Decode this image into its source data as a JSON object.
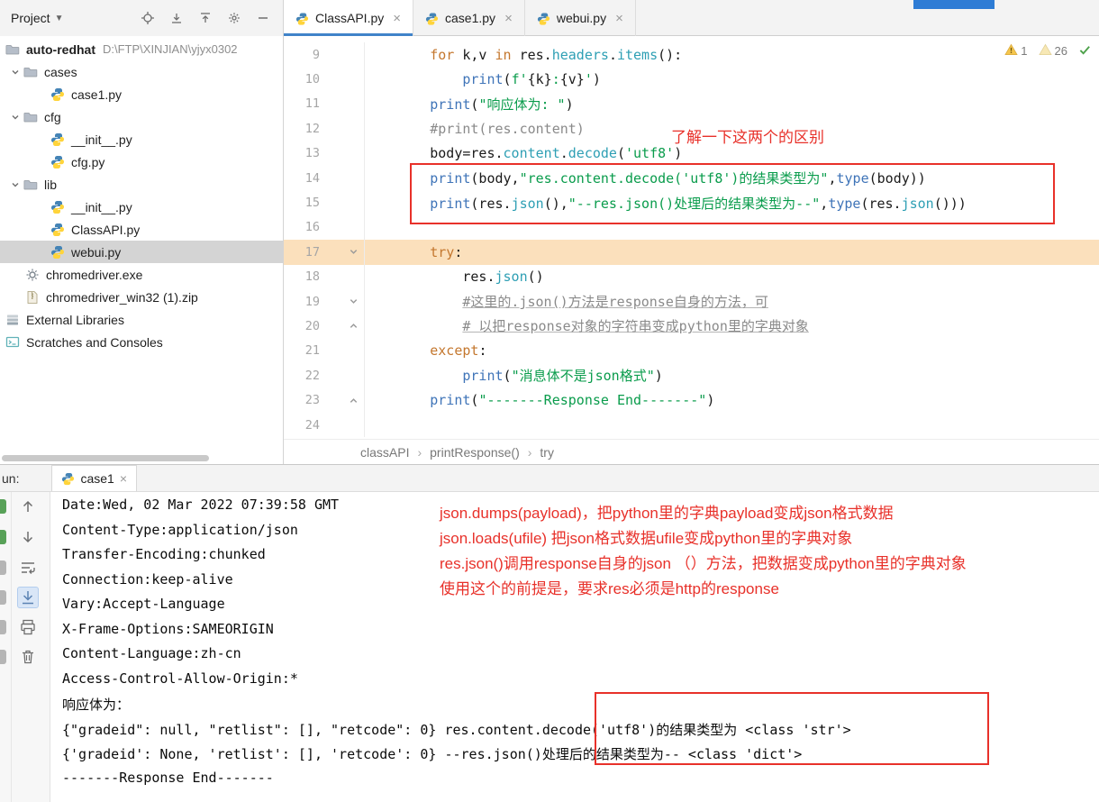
{
  "project_panel": {
    "header": {
      "title": "Project"
    },
    "tree": [
      {
        "label": "auto-redhat",
        "suffix": "D:\\FTP\\XINJIAN\\yjyx0302",
        "icon": "folder",
        "flush": true,
        "bold": true
      },
      {
        "label": "cases",
        "icon": "folder",
        "arrow": true
      },
      {
        "label": "case1.py",
        "icon": "python",
        "level": 1
      },
      {
        "label": "cfg",
        "icon": "folder",
        "arrow": true
      },
      {
        "label": "__init__.py",
        "icon": "python",
        "level": 1
      },
      {
        "label": "cfg.py",
        "icon": "python",
        "level": 1
      },
      {
        "label": "lib",
        "icon": "folder",
        "arrow": true
      },
      {
        "label": "__init__.py",
        "icon": "python",
        "level": 1
      },
      {
        "label": "ClassAPI.py",
        "icon": "python",
        "level": 1
      },
      {
        "label": "webui.py",
        "icon": "python",
        "level": 1,
        "selected": true
      },
      {
        "label": "chromedriver.exe",
        "icon": "exe",
        "level": 0
      },
      {
        "label": "chromedriver_win32 (1).zip",
        "icon": "zip",
        "level": 0
      },
      {
        "label": "External Libraries",
        "icon": "lib",
        "flush": true
      },
      {
        "label": "Scratches and Consoles",
        "icon": "scratch",
        "flush": true
      }
    ]
  },
  "editor_tabs": [
    {
      "label": "ClassAPI.py",
      "active": true
    },
    {
      "label": "case1.py",
      "active": false
    },
    {
      "label": "webui.py",
      "active": false
    }
  ],
  "inspections": {
    "warning_count": "1",
    "weak_count": "26"
  },
  "editor": {
    "highlight_line": 17,
    "gutter_icons": {
      "17": "fold",
      "19": "fold",
      "20": "foldend",
      "23": "foldend"
    },
    "lines": [
      {
        "num": 9,
        "tokens": [
          [
            "pl",
            "        "
          ],
          [
            "kw",
            "for"
          ],
          [
            "pl",
            " k,v "
          ],
          [
            "kw",
            "in"
          ],
          [
            "pl",
            " res."
          ],
          [
            "mt",
            "headers"
          ],
          [
            "pl",
            "."
          ],
          [
            "mt",
            "items"
          ],
          [
            "pl",
            "():"
          ]
        ]
      },
      {
        "num": 10,
        "tokens": [
          [
            "pl",
            "            "
          ],
          [
            "fn",
            "print"
          ],
          [
            "pl",
            "("
          ],
          [
            "st",
            "f'"
          ],
          [
            "pl",
            "{k}"
          ],
          [
            "st",
            ":"
          ],
          [
            "pl",
            "{v}"
          ],
          [
            "st",
            "'"
          ],
          [
            "pl",
            ")"
          ]
        ]
      },
      {
        "num": 11,
        "tokens": [
          [
            "pl",
            "        "
          ],
          [
            "fn",
            "print"
          ],
          [
            "pl",
            "("
          ],
          [
            "st",
            "\"响应体为: \""
          ],
          [
            "pl",
            ")"
          ]
        ]
      },
      {
        "num": 12,
        "tokens": [
          [
            "pl",
            "        "
          ],
          [
            "cm",
            "#print(res.content)"
          ]
        ]
      },
      {
        "num": 13,
        "tokens": [
          [
            "pl",
            "        "
          ],
          [
            "pl",
            "body="
          ],
          [
            "pl",
            "res."
          ],
          [
            "mt",
            "content"
          ],
          [
            "pl",
            "."
          ],
          [
            "mt",
            "decode"
          ],
          [
            "pl",
            "("
          ],
          [
            "st",
            "'utf8'"
          ],
          [
            "pl",
            ")"
          ]
        ]
      },
      {
        "num": 14,
        "tokens": [
          [
            "pl",
            "        "
          ],
          [
            "fn",
            "print"
          ],
          [
            "pl",
            "(body,"
          ],
          [
            "st",
            "\"res.content.decode('utf8')的结果类型为\""
          ],
          [
            "pl",
            ","
          ],
          [
            "fn",
            "type"
          ],
          [
            "pl",
            "(body))"
          ]
        ]
      },
      {
        "num": 15,
        "tokens": [
          [
            "pl",
            "        "
          ],
          [
            "fn",
            "print"
          ],
          [
            "pl",
            "(res."
          ],
          [
            "mt",
            "json"
          ],
          [
            "pl",
            "(),"
          ],
          [
            "st",
            "\"--res.json()处理后的结果类型为--\""
          ],
          [
            "pl",
            ","
          ],
          [
            "fn",
            "type"
          ],
          [
            "pl",
            "(res."
          ],
          [
            "mt",
            "json"
          ],
          [
            "pl",
            "()))"
          ]
        ]
      },
      {
        "num": 16,
        "tokens": []
      },
      {
        "num": 17,
        "tokens": [
          [
            "pl",
            "        "
          ],
          [
            "kw",
            "try"
          ],
          [
            "pl",
            ":"
          ]
        ]
      },
      {
        "num": 18,
        "tokens": [
          [
            "pl",
            "            "
          ],
          [
            "pl",
            "res."
          ],
          [
            "mt",
            "json"
          ],
          [
            "pl",
            "()"
          ]
        ]
      },
      {
        "num": 19,
        "tokens": [
          [
            "pl",
            "            "
          ],
          [
            "cu",
            "#这里的.json()方法是response自身的方法，可"
          ]
        ]
      },
      {
        "num": 20,
        "tokens": [
          [
            "pl",
            "            "
          ],
          [
            "cu",
            "# 以把response对象的字符串变成python里的字典对象"
          ]
        ]
      },
      {
        "num": 21,
        "tokens": [
          [
            "pl",
            "        "
          ],
          [
            "kw",
            "except"
          ],
          [
            "pl",
            ":"
          ]
        ]
      },
      {
        "num": 22,
        "tokens": [
          [
            "pl",
            "            "
          ],
          [
            "fn",
            "print"
          ],
          [
            "pl",
            "("
          ],
          [
            "st",
            "\"消息体不是json格式\""
          ],
          [
            "pl",
            ")"
          ]
        ]
      },
      {
        "num": 23,
        "tokens": [
          [
            "pl",
            "        "
          ],
          [
            "fn",
            "print"
          ],
          [
            "pl",
            "("
          ],
          [
            "st",
            "\"-------Response End-------\""
          ],
          [
            "pl",
            ")"
          ]
        ]
      },
      {
        "num": 24,
        "tokens": []
      }
    ]
  },
  "breadcrumbs": [
    "classAPI",
    "printResponse()",
    "try"
  ],
  "annotations": {
    "editor_note": "了解一下这两个的区别",
    "run_notes": [
      "json.dumps(payload)，把python里的字典payload变成json格式数据",
      "json.loads(ufile)  把json格式数据ufile变成python里的字典对象",
      "res.json()调用response自身的json （）方法，把数据变成python里的字典对象",
      "使用这个的前提是，要求res必须是http的response"
    ]
  },
  "run_panel": {
    "prefix": "un:",
    "tab_label": "case1",
    "console_lines": [
      "Date:Wed, 02 Mar 2022 07:39:58 GMT",
      "Content-Type:application/json",
      "Transfer-Encoding:chunked",
      "Connection:keep-alive",
      "Vary:Accept-Language",
      "X-Frame-Options:SAMEORIGIN",
      "Content-Language:zh-cn",
      "Access-Control-Allow-Origin:*",
      "响应体为：",
      "{\"gradeid\": null, \"retlist\": [], \"retcode\": 0} res.content.decode('utf8')的结果类型为 <class 'str'>",
      "{'gradeid': None, 'retlist': [], 'retcode': 0} --res.json()处理后的结果类型为-- <class 'dict'>",
      "-------Response End-------"
    ]
  },
  "colors": {
    "annotation_red": "#e8312a",
    "tab_underline": "#4083c9",
    "highlight_line_bg": "#fbe0bc",
    "selection_gray": "#d4d4d4"
  }
}
